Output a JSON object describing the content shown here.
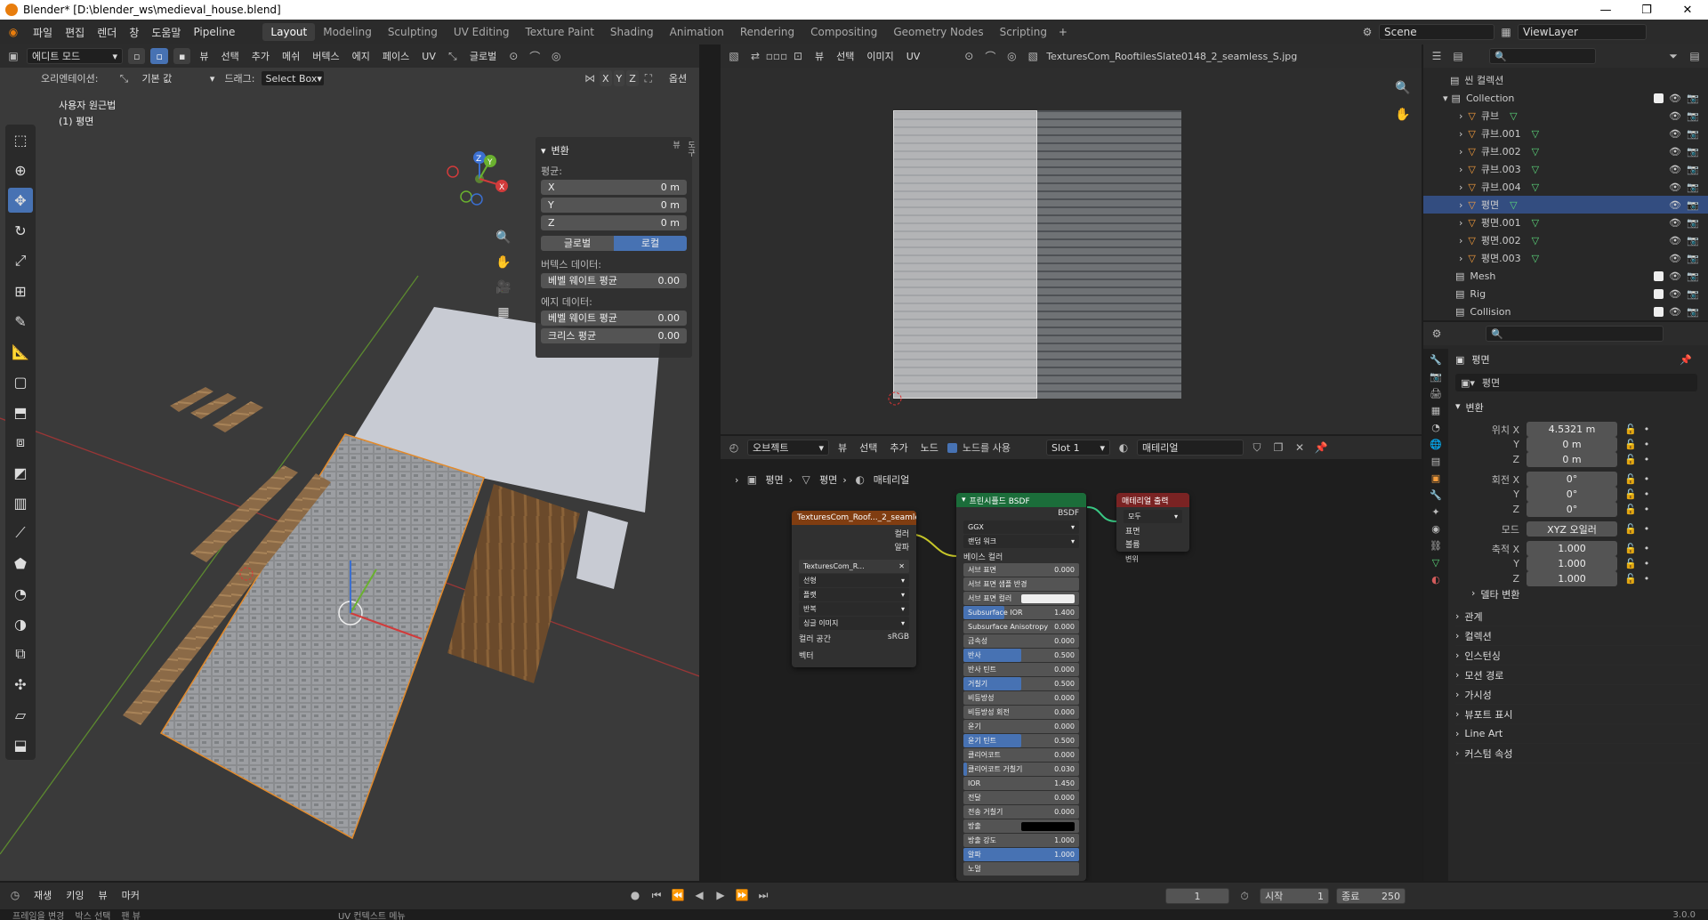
{
  "window": {
    "title": "Blender* [D:\\blender_ws\\medieval_house.blend]"
  },
  "topmenu": [
    "파일",
    "편집",
    "렌더",
    "창",
    "도움말",
    "Pipeline"
  ],
  "workspaces": [
    "Layout",
    "Modeling",
    "Sculpting",
    "UV Editing",
    "Texture Paint",
    "Shading",
    "Animation",
    "Rendering",
    "Compositing",
    "Geometry Nodes",
    "Scripting"
  ],
  "scene": {
    "scene_name": "Scene",
    "view_layer": "ViewLayer"
  },
  "viewport": {
    "mode": "에디트 모드",
    "menu": [
      "뷰",
      "선택",
      "추가",
      "메쉬",
      "버텍스",
      "에지",
      "페이스",
      "UV"
    ],
    "transform_orientation": "글로벌",
    "orientation_label": "오리엔테이션:",
    "orientation_value": "기본 값",
    "drag_label": "드래그:",
    "drag_value": "Select Box",
    "axes": [
      "X",
      "Y",
      "Z"
    ],
    "options": "옵션",
    "view_name": "사용자 원근법",
    "object_name": "(1) 평면"
  },
  "npanel": {
    "header": "변환",
    "median": "평균:",
    "x_label": "X",
    "x_value": "0 m",
    "y_label": "Y",
    "y_value": "0 m",
    "z_label": "Z",
    "z_value": "0 m",
    "global": "글로벌",
    "local": "로컬",
    "vertex_data": "버텍스 데이터:",
    "bevel_weight_label": "베벨 웨이트 평균",
    "bevel_weight_v": "0.00",
    "edge_data": "에지 데이터:",
    "edge_bevel_label": "베벨 웨이트 평균",
    "edge_bevel_v": "0.00",
    "crease_label": "크리스 평균",
    "crease_v": "0.00",
    "tabs": [
      "항목",
      "도구",
      "뷰"
    ]
  },
  "image_editor": {
    "menu": [
      "뷰",
      "선택",
      "이미지",
      "UV"
    ],
    "image_name": "TexturesCom_RooftilesSlate0148_2_seamless_S.jpg"
  },
  "node_editor": {
    "type": "오브젝트",
    "menu": [
      "뷰",
      "선택",
      "추가",
      "노드"
    ],
    "use_nodes": "노드를 사용",
    "slot": "Slot 1",
    "material": "매테리얼",
    "breadcrumb": [
      "평면",
      "평면",
      "매테리얼"
    ],
    "tex_node": {
      "title": "TexturesCom_Roof..._2_seamless_S.jpg",
      "out_color": "컬러",
      "out_alpha": "알파",
      "image": "TexturesCom_R...",
      "interp": "선형",
      "proj": "플랫",
      "ext": "반복",
      "source": "싱글 이미지",
      "colorspace_label": "컬러 공간",
      "colorspace": "sRGB",
      "vector": "벡터"
    },
    "bsdf": {
      "title": "프린시플드 BSDF",
      "out": "BSDF",
      "dist": "GGX",
      "sss_method": "랜덤 워크",
      "base_color": "베이스 컬러",
      "rows": [
        {
          "label": "서브 표면",
          "value": "0.000",
          "fill": 0
        },
        {
          "label": "서브 표면 샘플 반경",
          "value": "",
          "fill": 0
        },
        {
          "label": "서브 표면 컬러",
          "value": "",
          "fill": 0
        },
        {
          "label": "Subsurface IOR",
          "value": "1.400",
          "fill": 0.35
        },
        {
          "label": "Subsurface Anisotropy",
          "value": "0.000",
          "fill": 0
        },
        {
          "label": "금속성",
          "value": "0.000",
          "fill": 0
        },
        {
          "label": "반사",
          "value": "0.500",
          "fill": 0.5
        },
        {
          "label": "반사 틴트",
          "value": "0.000",
          "fill": 0
        },
        {
          "label": "거칠기",
          "value": "0.500",
          "fill": 0.5
        },
        {
          "label": "비등방성",
          "value": "0.000",
          "fill": 0
        },
        {
          "label": "비등방성 회전",
          "value": "0.000",
          "fill": 0
        },
        {
          "label": "윤기",
          "value": "0.000",
          "fill": 0
        },
        {
          "label": "윤기 틴트",
          "value": "0.500",
          "fill": 0.5
        },
        {
          "label": "클리어코트",
          "value": "0.000",
          "fill": 0
        },
        {
          "label": "클리어코트 거칠기",
          "value": "0.030",
          "fill": 0.03
        },
        {
          "label": "IOR",
          "value": "1.450",
          "fill": 0
        },
        {
          "label": "전달",
          "value": "0.000",
          "fill": 0
        },
        {
          "label": "전송 거칠기",
          "value": "0.000",
          "fill": 0
        },
        {
          "label": "방출",
          "value": "",
          "fill": 0
        },
        {
          "label": "방출 강도",
          "value": "1.000",
          "fill": 0
        },
        {
          "label": "알파",
          "value": "1.000",
          "fill": 1
        },
        {
          "label": "노멀",
          "value": "",
          "fill": 0
        }
      ]
    },
    "output": {
      "title": "매테리얼 출력",
      "target": "모두",
      "in_surface": "표면",
      "in_volume": "볼륨",
      "in_disp": "변위"
    }
  },
  "outliner": {
    "root": "씬 컬렉션",
    "collection": "Collection",
    "items": [
      "큐브",
      "큐브.001",
      "큐브.002",
      "큐브.003",
      "큐브.004",
      "평면",
      "평면.001",
      "평면.002",
      "평면.003"
    ],
    "selected": "평면",
    "other": [
      "Mesh",
      "Rig",
      "Collision"
    ]
  },
  "properties": {
    "object": "평면",
    "data": "평면",
    "transform": "변환",
    "loc_label": "위치 X",
    "loc_x": "4.5321 m",
    "loc_y": "0 m",
    "loc_z": "0 m",
    "rot_label": "회전 X",
    "rot_x": "0°",
    "rot_y": "0°",
    "rot_z": "0°",
    "mode_label": "모드",
    "mode": "XYZ 오일러",
    "scale_label": "축적 X",
    "scale_x": "1.000",
    "scale_y": "1.000",
    "scale_z": "1.000",
    "y": "Y",
    "z": "Z",
    "delta": "델타 변환",
    "sections": [
      "관계",
      "컬렉션",
      "인스턴싱",
      "모션 경로",
      "가시성",
      "뷰포트 표시",
      "Line Art",
      "커스텀 속성"
    ]
  },
  "timeline": {
    "menu": [
      "재생",
      "키잉",
      "뷰",
      "마커"
    ],
    "frame": "1",
    "start_label": "시작",
    "start": "1",
    "end_label": "종료",
    "end": "250"
  },
  "status": {
    "hints": [
      "프레임을 변경",
      "박스 선택",
      "팬 뷰",
      "UV 컨텍스트 메뉴"
    ],
    "version": "3.0.0"
  },
  "colors": {
    "accent": "#4772b3",
    "bg": "#303030",
    "header": "#2c2c2c"
  }
}
